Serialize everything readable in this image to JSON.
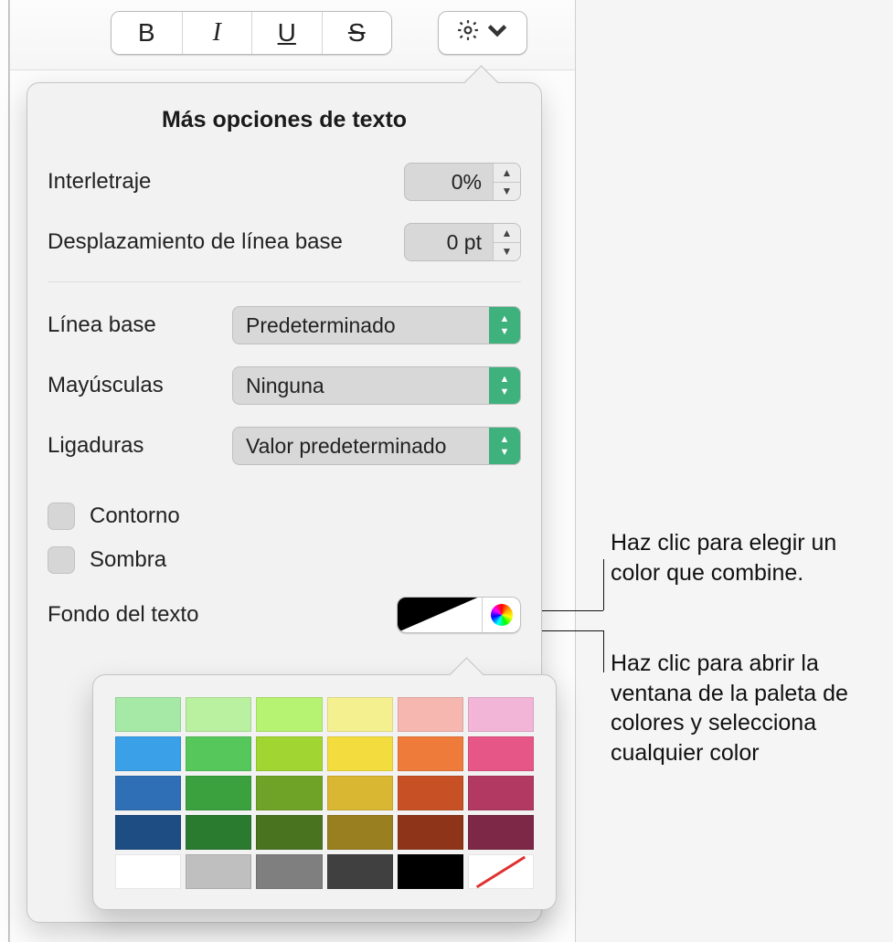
{
  "toolbar": {
    "bold": "B",
    "italic": "I",
    "underline": "U",
    "strike": "S"
  },
  "popover": {
    "title": "Más opciones de texto",
    "tracking_label": "Interletraje",
    "tracking_value": "0%",
    "baseline_shift_label": "Desplazamiento de línea base",
    "baseline_shift_value": "0 pt",
    "baseline_label": "Línea base",
    "baseline_value": "Predeterminado",
    "caps_label": "Mayúsculas",
    "caps_value": "Ninguna",
    "ligatures_label": "Ligaduras",
    "ligatures_value": "Valor predeterminado",
    "outline_label": "Contorno",
    "shadow_label": "Sombra",
    "textbg_label": "Fondo del texto"
  },
  "color_grid": {
    "rows": [
      [
        "#a6e9a6",
        "#b9f1a0",
        "#b7f372",
        "#f5f08f",
        "#f5b7b0",
        "#f2b5d8"
      ],
      [
        "#3aa0e8",
        "#56c75b",
        "#a1d531",
        "#f3dd3e",
        "#ef7b3a",
        "#e65686"
      ],
      [
        "#2e6fb6",
        "#3aa13e",
        "#6fa327",
        "#d9b732",
        "#c75124",
        "#b23a62"
      ],
      [
        "#1e4d84",
        "#2a7a30",
        "#4a7320",
        "#9a7f20",
        "#8e3519",
        "#7c2846"
      ]
    ],
    "last_row": [
      "#ffffff",
      "#bfbfbf",
      "#7f7f7f",
      "#404040",
      "#000000",
      "none"
    ]
  },
  "callouts": {
    "swatch": "Haz clic para elegir un color que combine.",
    "wheel": "Haz clic para abrir la ventana de la paleta de colores y selecciona cualquier color"
  }
}
